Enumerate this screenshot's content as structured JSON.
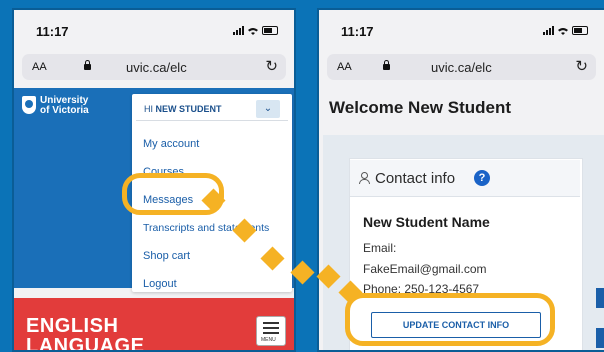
{
  "phone_left": {
    "time": "11:17",
    "aa_label": "AA",
    "url": "uvic.ca/elc",
    "reload_glyph": "↻",
    "logo_line1": "University",
    "logo_line2": "of Victoria",
    "greeting": "HI NEW STUDENT",
    "greeting_prefix": "HI ",
    "greeting_name": "NEW STUDENT",
    "chevron_glyph": "⌄",
    "menu_items": [
      "My account",
      "Courses",
      "Messages",
      "Transcripts and statements",
      "Shop cart",
      "Logout"
    ],
    "banner_line1": "ENGLISH",
    "banner_line2": "LANGUAGE",
    "menu_button_label": "MENU",
    "accent_color": "#1a6fb8",
    "banner_color": "#e23c3b"
  },
  "phone_right": {
    "time": "11:17",
    "aa_label": "AA",
    "url": "uvic.ca/elc",
    "reload_glyph": "↻",
    "welcome": "Welcome New Student",
    "contact_title": "Contact info",
    "help_glyph": "?",
    "student_name": "New Student Name",
    "email_label": "Email:",
    "email_value": "FakeEmail@gmail.com",
    "phone_line": "Phone:  250-123-4567",
    "update_button": "UPDATE CONTACT INFO"
  },
  "overlay": {
    "highlight_color": "#f5b224",
    "arrow_icon": "dotted-arrow"
  }
}
